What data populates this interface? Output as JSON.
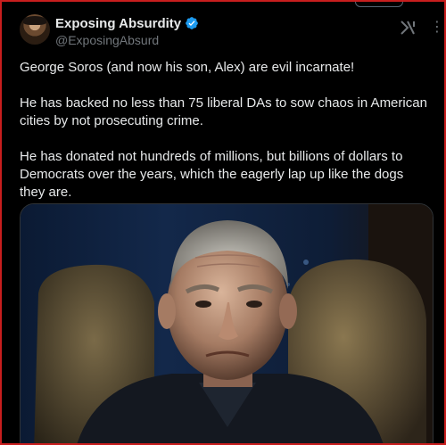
{
  "author": {
    "display_name": "Exposing Absurdity",
    "handle": "@ExposingAbsurd",
    "verified": true
  },
  "tweet": {
    "paragraphs": [
      "George Soros (and now his son, Alex) are evil incarnate!",
      "He has backed no less than 75 liberal DAs to sow chaos in American cities by not prosecuting crime.",
      "He has donated not hundreds of millions, but billions of dollars to Democrats over the years, which the eagerly lap up like the dogs they are."
    ]
  },
  "icons": {
    "verified": "verified-badge-icon",
    "grok": "grok-icon",
    "more": "more-icon"
  },
  "colors": {
    "background": "#000000",
    "text": "#e7e9ea",
    "secondary_text": "#71767b",
    "verified_blue": "#1d9bf0",
    "frame_border": "#c81e1e"
  }
}
